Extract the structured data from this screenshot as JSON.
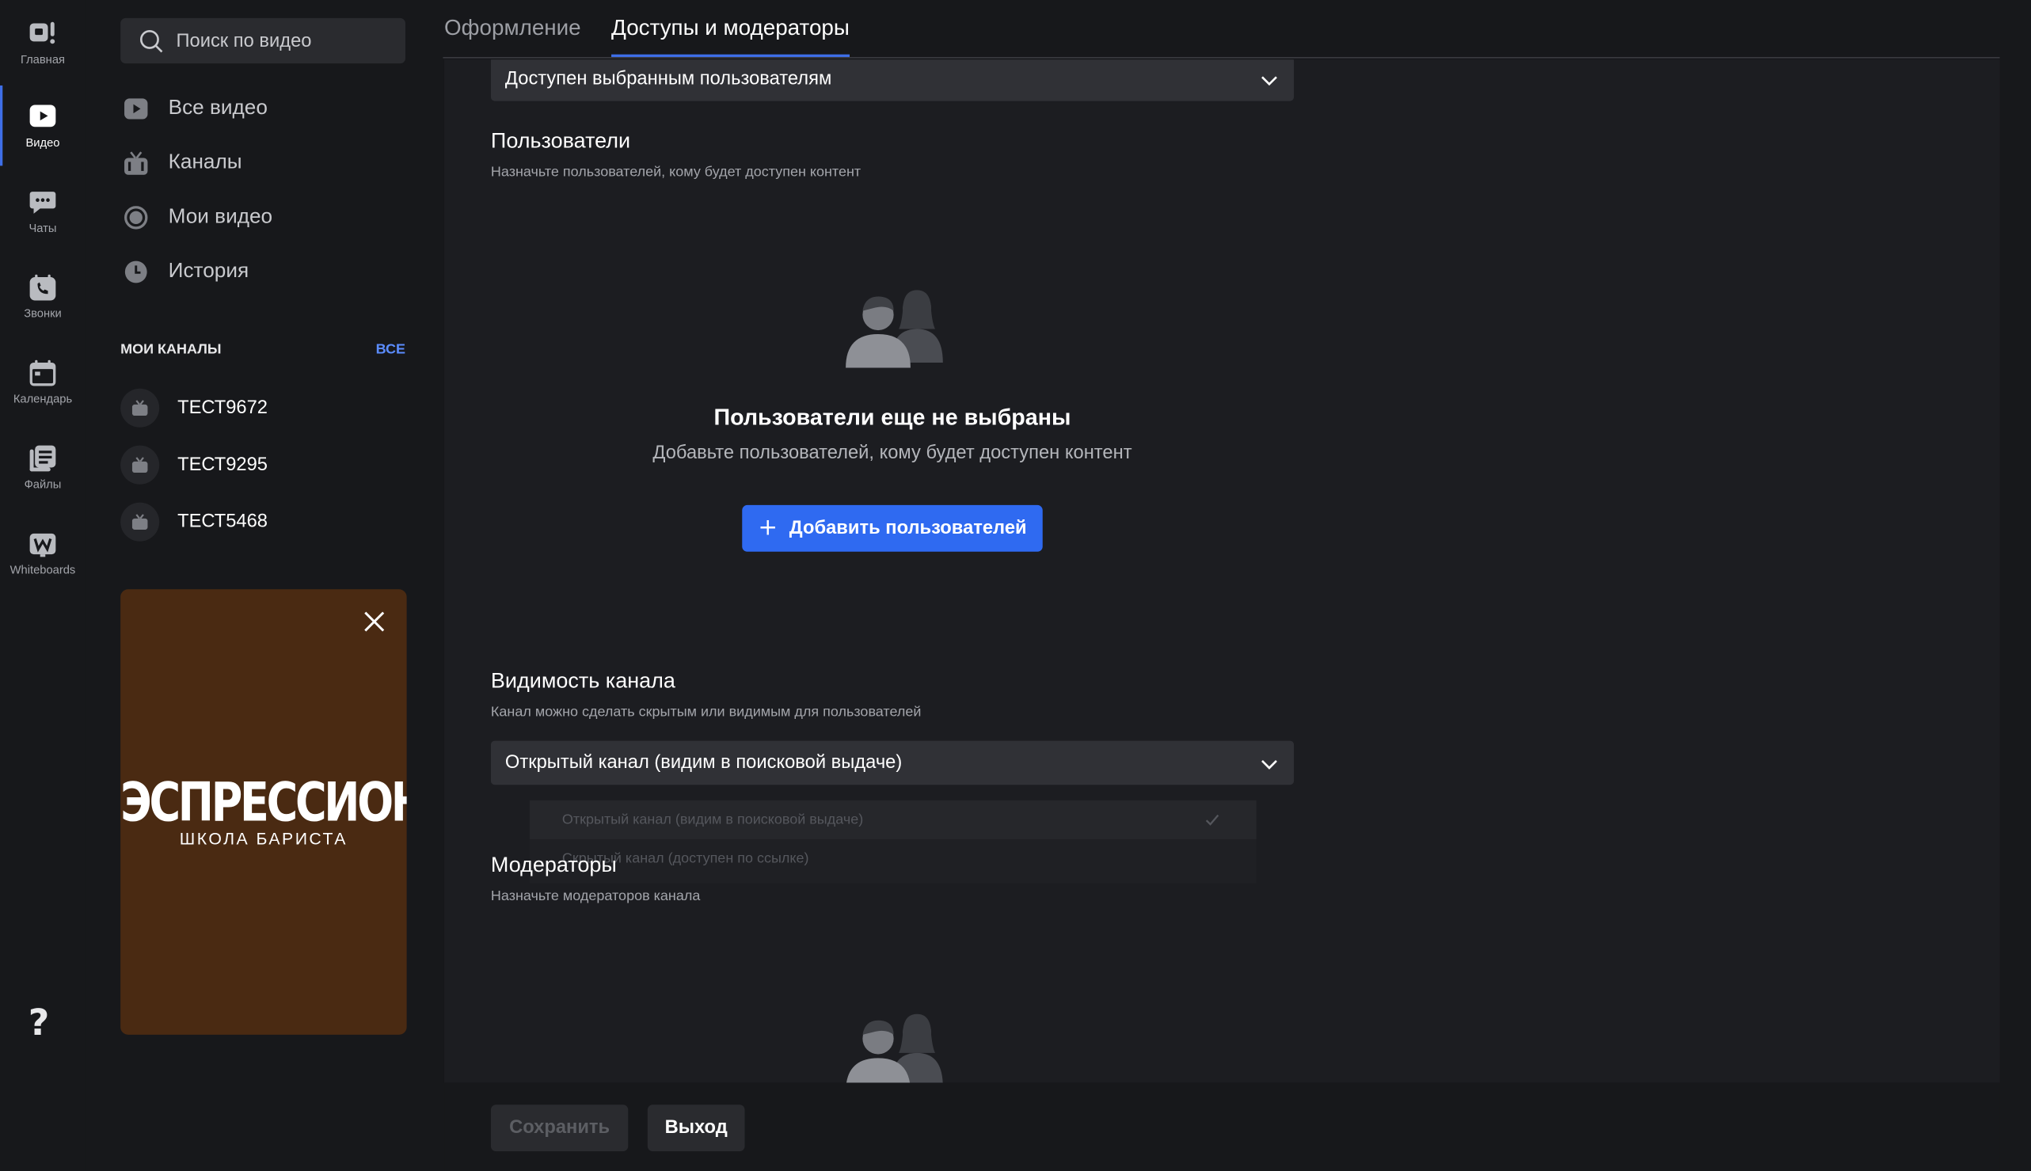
{
  "rail": {
    "items": [
      {
        "label": "Главная",
        "icon": "home-icon"
      },
      {
        "label": "Видео",
        "icon": "video-icon"
      },
      {
        "label": "Чаты",
        "icon": "chat-icon"
      },
      {
        "label": "Звонки",
        "icon": "phone-icon"
      },
      {
        "label": "Календарь",
        "icon": "calendar-icon"
      },
      {
        "label": "Файлы",
        "icon": "files-icon"
      },
      {
        "label": "Whiteboards",
        "icon": "whiteboard-icon"
      }
    ],
    "help": "?"
  },
  "sidebar": {
    "search_placeholder": "Поиск по видео",
    "nav": [
      {
        "label": "Все видео",
        "icon": "play-icon"
      },
      {
        "label": "Каналы",
        "icon": "tv-icon"
      },
      {
        "label": "Мои видео",
        "icon": "record-icon"
      },
      {
        "label": "История",
        "icon": "clock-icon"
      }
    ],
    "my_channels_title": "МОИ КАНАЛЫ",
    "all_link": "ВСЕ",
    "channels": [
      "ТЕСТ9672",
      "ТЕСТ9295",
      "ТЕСТ5468"
    ],
    "promo": {
      "brand": "ЭСПРЕССИОНИСТ",
      "subtitle": "ШКОЛА БАРИСТА",
      "bg": "#4a2a12"
    }
  },
  "tabs": [
    {
      "label": "Оформление"
    },
    {
      "label": "Доступы и модераторы"
    }
  ],
  "access": {
    "select_value": "Доступен выбранным пользователям"
  },
  "users": {
    "title": "Пользователи",
    "hint": "Назначьте пользователей, кому будет доступен контент",
    "empty_title": "Пользователи еще не выбраны",
    "empty_sub": "Добавьте пользователей, кому будет доступен контент",
    "add_button": "Добавить пользователей"
  },
  "visibility": {
    "title": "Видимость канала",
    "hint": "Канал можно сделать скрытым или видимым для пользователей",
    "select_value": "Открытый канал (видим в поисковой выдаче)",
    "options": [
      "Открытый канал (видим в поисковой выдаче)",
      "Скрытый канал (доступен по ссылке)"
    ]
  },
  "moderators": {
    "title": "Модераторы",
    "hint": "Назначьте модераторов канала"
  },
  "footer": {
    "save": "Сохранить",
    "exit": "Выход"
  },
  "colors": {
    "accent": "#2f6af1",
    "link": "#5b8cff",
    "bg": "#17181b",
    "panel": "#1c1d21"
  }
}
